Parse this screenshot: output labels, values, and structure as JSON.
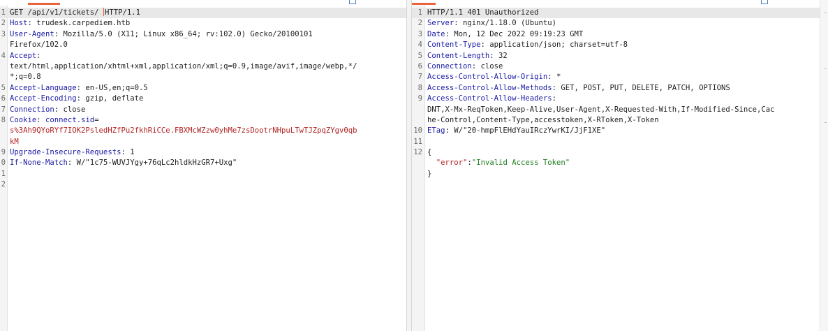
{
  "request": {
    "lines": [
      {
        "n": "1",
        "parts": [
          {
            "t": "GET /api/v1/tickets/ ",
            "c": "plain"
          },
          {
            "t": "",
            "c": "caret"
          },
          {
            "t": "HTTP/1.1",
            "c": "plain"
          }
        ]
      },
      {
        "n": "2",
        "parts": [
          {
            "t": "Host",
            "c": "hname"
          },
          {
            "t": ": trudesk.carpediem.htb",
            "c": "plain"
          }
        ]
      },
      {
        "n": "3",
        "parts": [
          {
            "t": "User-Agent",
            "c": "hname"
          },
          {
            "t": ": Mozilla/5.0 (X11; Linux x86_64; rv:102.0) Gecko/20100101",
            "c": "plain"
          }
        ]
      },
      {
        "n": "",
        "parts": [
          {
            "t": "Firefox/102.0",
            "c": "plain"
          }
        ]
      },
      {
        "n": "4",
        "parts": [
          {
            "t": "Accept",
            "c": "hname"
          },
          {
            "t": ":",
            "c": "plain"
          }
        ]
      },
      {
        "n": "",
        "parts": [
          {
            "t": "text/html,application/xhtml+xml,application/xml;q=0.9,image/avif,image/webp,*/",
            "c": "plain"
          }
        ]
      },
      {
        "n": "",
        "parts": [
          {
            "t": "*;q=0.8",
            "c": "plain"
          }
        ]
      },
      {
        "n": "5",
        "parts": [
          {
            "t": "Accept-Language",
            "c": "hname"
          },
          {
            "t": ": en-US,en;q=0.5",
            "c": "plain"
          }
        ]
      },
      {
        "n": "6",
        "parts": [
          {
            "t": "Accept-Encoding",
            "c": "hname"
          },
          {
            "t": ": gzip, deflate",
            "c": "plain"
          }
        ]
      },
      {
        "n": "7",
        "parts": [
          {
            "t": "Connection",
            "c": "hname"
          },
          {
            "t": ": close",
            "c": "plain"
          }
        ]
      },
      {
        "n": "8",
        "parts": [
          {
            "t": "Cookie",
            "c": "hname"
          },
          {
            "t": ": ",
            "c": "plain"
          },
          {
            "t": "connect.sid",
            "c": "hname"
          },
          {
            "t": "=",
            "c": "plain"
          }
        ]
      },
      {
        "n": "",
        "parts": [
          {
            "t": "s%3Ah9QYoRYf7IOK2PsledHZfPu2fkhRiCCe.FBXMcWZzw0yhMe7zsDootrNHpuLTwTJZpqZYgv0qb",
            "c": "cookie-val"
          }
        ]
      },
      {
        "n": "",
        "parts": [
          {
            "t": "kM",
            "c": "cookie-val"
          }
        ]
      },
      {
        "n": "9",
        "parts": [
          {
            "t": "Upgrade-Insecure-Requests",
            "c": "hname"
          },
          {
            "t": ": 1",
            "c": "plain"
          }
        ]
      },
      {
        "n": "0",
        "parts": [
          {
            "t": "If-None-Match",
            "c": "hname"
          },
          {
            "t": ": W/\"1c75-WUVJYgy+76qLc2hldkHzGR7+Uxg\"",
            "c": "plain"
          }
        ]
      },
      {
        "n": "1",
        "parts": []
      },
      {
        "n": "2",
        "parts": []
      }
    ]
  },
  "response": {
    "lines": [
      {
        "n": "1",
        "parts": [
          {
            "t": "HTTP/1.1 401 Unauthorized",
            "c": "plain"
          }
        ]
      },
      {
        "n": "2",
        "parts": [
          {
            "t": "Server",
            "c": "hname"
          },
          {
            "t": ": nginx/1.18.0 (Ubuntu)",
            "c": "plain"
          }
        ]
      },
      {
        "n": "3",
        "parts": [
          {
            "t": "Date",
            "c": "hname"
          },
          {
            "t": ": Mon, 12 Dec 2022 09:19:23 GMT",
            "c": "plain"
          }
        ]
      },
      {
        "n": "4",
        "parts": [
          {
            "t": "Content-Type",
            "c": "hname"
          },
          {
            "t": ": application/json; charset=utf-8",
            "c": "plain"
          }
        ]
      },
      {
        "n": "5",
        "parts": [
          {
            "t": "Content-Length",
            "c": "hname"
          },
          {
            "t": ": 32",
            "c": "plain"
          }
        ]
      },
      {
        "n": "6",
        "parts": [
          {
            "t": "Connection",
            "c": "hname"
          },
          {
            "t": ": close",
            "c": "plain"
          }
        ]
      },
      {
        "n": "7",
        "parts": [
          {
            "t": "Access-Control-Allow-Origin",
            "c": "hname"
          },
          {
            "t": ": *",
            "c": "plain"
          }
        ]
      },
      {
        "n": "8",
        "parts": [
          {
            "t": "Access-Control-Allow-Methods",
            "c": "hname"
          },
          {
            "t": ": GET, POST, PUT, DELETE, PATCH, OPTIONS",
            "c": "plain"
          }
        ]
      },
      {
        "n": "9",
        "parts": [
          {
            "t": "Access-Control-Allow-Headers",
            "c": "hname"
          },
          {
            "t": ":",
            "c": "plain"
          }
        ]
      },
      {
        "n": "",
        "parts": [
          {
            "t": "DNT,X-Mx-ReqToken,Keep-Alive,User-Agent,X-Requested-With,If-Modified-Since,Cac",
            "c": "plain"
          }
        ]
      },
      {
        "n": "",
        "parts": [
          {
            "t": "he-Control,Content-Type,accesstoken,X-RToken,X-Token",
            "c": "plain"
          }
        ]
      },
      {
        "n": "10",
        "parts": [
          {
            "t": "ETag",
            "c": "hname"
          },
          {
            "t": ": W/\"20-hmpFlEHdYauIRczYwrKI/JjF1XE\"",
            "c": "plain"
          }
        ]
      },
      {
        "n": "11",
        "parts": []
      },
      {
        "n": "12",
        "parts": [
          {
            "t": "{",
            "c": "plain"
          }
        ]
      },
      {
        "n": "",
        "parts": [
          {
            "t": "  ",
            "c": "plain"
          },
          {
            "t": "\"error\"",
            "c": "json-key"
          },
          {
            "t": ":",
            "c": "plain"
          },
          {
            "t": "\"Invalid Access Token\"",
            "c": "json-str"
          }
        ]
      },
      {
        "n": "",
        "parts": [
          {
            "t": "}",
            "c": "plain"
          }
        ]
      }
    ]
  }
}
